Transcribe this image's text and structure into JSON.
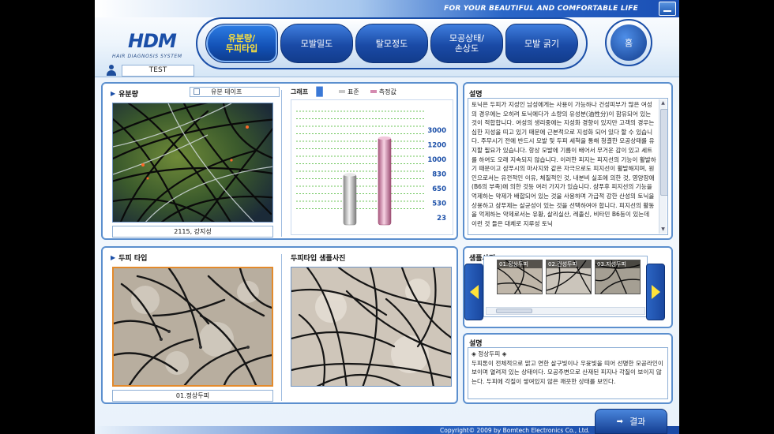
{
  "header": {
    "slogan": "FOR YOUR BEAUTIFUL AND COMFORTABLE LIFE",
    "logo": "HDM",
    "logo_sub": "HAIR DIAGNOSIS SYSTEM",
    "user_name": "TEST",
    "home_label": "홈"
  },
  "nav": {
    "items": [
      {
        "label_line1": "유분량/",
        "label_line2": "두피타입",
        "active": true
      },
      {
        "label_line1": "모발밀도",
        "label_line2": ""
      },
      {
        "label_line1": "탈모정도",
        "label_line2": ""
      },
      {
        "label_line1": "모공상태/",
        "label_line2": "손상도"
      },
      {
        "label_line1": "모발 굵기",
        "label_line2": ""
      }
    ]
  },
  "oil": {
    "title": "유분량",
    "taping_label": "유분 테이프",
    "photo_caption": "2115, 강지성"
  },
  "chart_data": {
    "type": "bar",
    "title": "그래프",
    "series": [
      {
        "name": "표준",
        "values": [
          830
        ],
        "color": "#c8c8c8"
      },
      {
        "name": "측정값",
        "values": [
          2115
        ],
        "color": "#d48ab0"
      }
    ],
    "y_tick_labels": [
      "3000",
      "1200",
      "1000",
      "830",
      "650",
      "530",
      "23"
    ],
    "legend_position": "top",
    "grid": true
  },
  "desc1": {
    "title": "설명",
    "text": "토닉은 두피가 지성인 남성에게는 사용이 가능하나 건성피부가 많은 여성의 경우에는 오히려 토닉에다가 소량의 유성분(油性分)이 함유되어 있는 것이 적합합니다. 여성의 생리중에는 지성화 경향이 있지만 고객의 경우는 심한 지성을 띠고 있기 때문에 근본적으로 지성화 되어 있다 할 수 있습니다. 주무시기 전에 반드시 모발 및 두피 세척을 통해 청결한 모공상태를 유지할 필요가 있습니다. 항상 모발에 기름이 배어서 무거운 감이 있고 세트를 하여도 오래 지속되지 않습니다. 이러한 피지는 피지선의 기능이 활발하기 때문이고 샴푸시의 마사지와 같은 자극으로도 피지선이 활발해지며, 원인으로서는 유전적인 이유, 체질적인 것, 내분비 실조에 의한 것, 영양장애(B6의 부족)에 의한 것등 여러 가지가 있습니다. 샴푸후 피지선의 기능을 억제하는 약제가 배합되어 있는 것을 사용하며 가급적 강한 산성의 토닉을 상용하고 샴푸제는 살균성이 있는 것을 선택하여야 합니다. 피지선의 활동을 억제하는 약제로서는 유황, 살리실산, 레졸신, 비타민 B6등이 있는데 이런 것 들은 대체로 지루성 토닉"
  },
  "scalp": {
    "title": "두피 타입",
    "photo_caption": "01.정상두피",
    "sample_photo_title": "두피타입 샘플사진"
  },
  "samples": {
    "title": "샘플사진",
    "thumbs": [
      "01.정상두피",
      "02.건성두피",
      "03.지성두피"
    ]
  },
  "desc2": {
    "title": "설명",
    "heading": "◈ 정상두피 ◈",
    "text": "두피톤이 전체적으로 맑고 연한 살구빛이나 우윳빛을 띠어 선명한 모공라인이 보이며 열려져 있는 상태이다. 모공주변으로 산재된 피지나 각질이 보이지 않는다. 두피에 각질이 쌓여있지 않은 깨끗한 상태를 보인다."
  },
  "footer": {
    "result_label": "결과",
    "copyright": "Copyright© 2009 by Bomtech Electronics Co., Ltd."
  }
}
